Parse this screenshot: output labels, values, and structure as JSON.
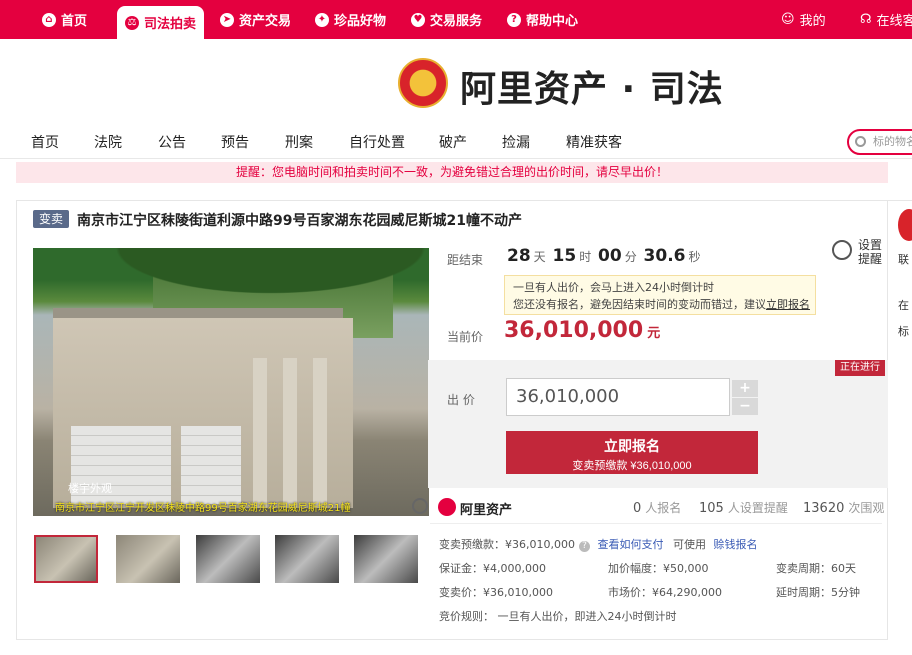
{
  "topnav": {
    "home": "首页",
    "judicial": "司法拍卖",
    "asset_trade": "资产交易",
    "treasures": "珍品好物",
    "trade_service": "交易服务",
    "help": "帮助中心",
    "my": "我的",
    "online": "在线客"
  },
  "brand": {
    "name": "阿里资产 · 司法"
  },
  "mainnav": {
    "items": [
      "首页",
      "法院",
      "公告",
      "预告",
      "刑案",
      "自行处置",
      "破产",
      "捡漏",
      "精准获客"
    ]
  },
  "search": {
    "placeholder": "标的物名"
  },
  "notice": "提醒：您电脑时间和拍卖时间不一致，为避免错过合理的出价时间，请尽早出价！",
  "item": {
    "tag": "变卖",
    "title": "南京市江宁区秣陵街道利源中路99号百家湖东花园威尼斯城21幢不动产",
    "image_caption": "南京市江宁区江宁开发区秣陵中路99号百家湖东花园威尼斯城21幢",
    "image_watermark": "楼宇外观"
  },
  "countdown": {
    "label": "距结束",
    "days": "28",
    "days_unit": "天",
    "hours": "15",
    "hours_unit": "时",
    "minutes": "00",
    "minutes_unit": "分",
    "seconds": "30.6",
    "seconds_unit": "秒"
  },
  "remind": {
    "label": "设置提醒"
  },
  "tip": {
    "line1": "一旦有人出价，会马上进入24小时倒计时",
    "line2": "您还没有报名，避免因结束时间的变动而错过，建议",
    "link": "立即报名"
  },
  "price": {
    "label": "当前价",
    "value": "36,010,000",
    "unit": "元"
  },
  "status": "正在进行",
  "bid": {
    "label": "出 价",
    "value": "36,010,000",
    "plus": "+",
    "minus": "−"
  },
  "apply_button": {
    "label": "立即报名",
    "sub": "变卖预缴款 ¥36,010,000"
  },
  "stats": {
    "brand": "阿里资产",
    "signups": "0",
    "signups_label": "人报名",
    "reminders": "105",
    "reminders_label": "人设置提醒",
    "views": "13620",
    "views_label": "次围观"
  },
  "details": {
    "deposit_label": "变卖预缴款：¥36,010,000",
    "how_pay": "查看如何支付",
    "can_use": "可使用",
    "loan_link": "赊钱报名",
    "guarantee": "保证金：¥4,000,000",
    "increment": "加价幅度：¥50,000",
    "period": "变卖周期：60天",
    "sale_price": "变卖价：¥36,010,000",
    "market_price": "市场价：¥64,290,000",
    "extension": "延时周期：5分钟",
    "rule": "竞价规则： 一旦有人出价，即进入24小时倒计时"
  },
  "right": {
    "line1": "联",
    "line2": "在",
    "line3": "标"
  },
  "colors": {
    "brand_red": "#e4003f",
    "price_red": "#c2273a",
    "tag_bg": "#5a6a8a"
  }
}
